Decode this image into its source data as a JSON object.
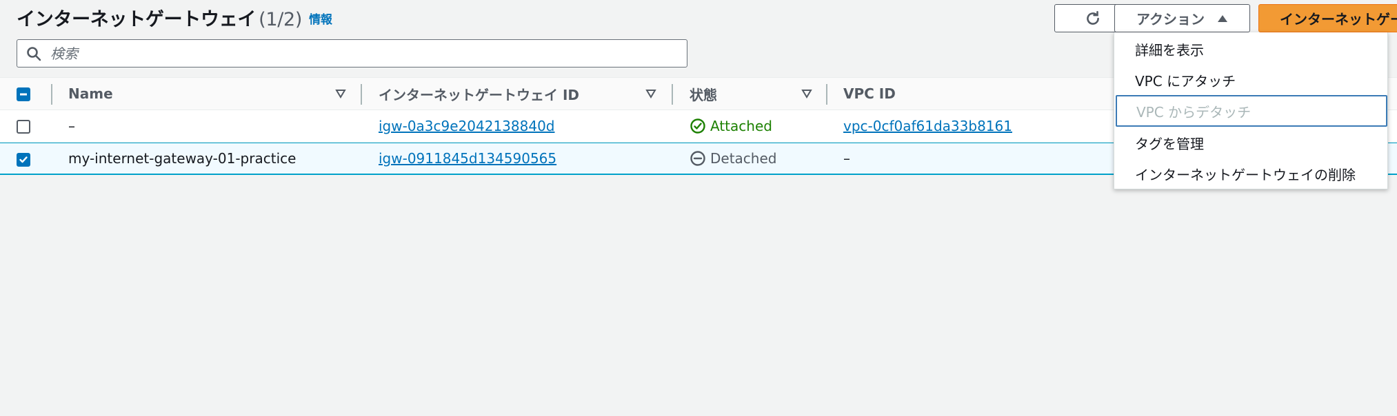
{
  "header": {
    "title": "インターネットゲートウェイ",
    "count": "(1/2)",
    "info_link": "情報",
    "actions_label": "アクション",
    "create_label": "インターネットゲートウェイの作成"
  },
  "search": {
    "placeholder": "検索",
    "value": ""
  },
  "table": {
    "columns": [
      "Name",
      "インターネットゲートウェイ ID",
      "状態",
      "VPC ID"
    ],
    "rows": [
      {
        "name": "–",
        "igw_id": "igw-0a3c9e2042138840d",
        "state": "Attached",
        "vpc_id": "vpc-0cf0af61da33b8161",
        "selected": false
      },
      {
        "name": "my-internet-gateway-01-practice",
        "igw_id": "igw-0911845d134590565",
        "state": "Detached",
        "vpc_id": "–",
        "selected": true
      }
    ]
  },
  "actions_menu": {
    "items": [
      {
        "label": "詳細を表示",
        "disabled": false
      },
      {
        "label": "VPC にアタッチ",
        "disabled": false
      },
      {
        "label": "VPC からデタッチ",
        "disabled": true
      },
      {
        "label": "タグを管理",
        "disabled": false
      },
      {
        "label": "インターネットゲートウェイの削除",
        "disabled": false
      }
    ]
  },
  "colors": {
    "primary": "#f29a34",
    "link": "#0073bb",
    "attached": "#1d8102",
    "detached": "#545b64"
  },
  "icons": [
    "refresh-icon",
    "caret-up-icon",
    "search-icon",
    "sort-icon",
    "check-circle-icon",
    "minus-circle-icon"
  ]
}
